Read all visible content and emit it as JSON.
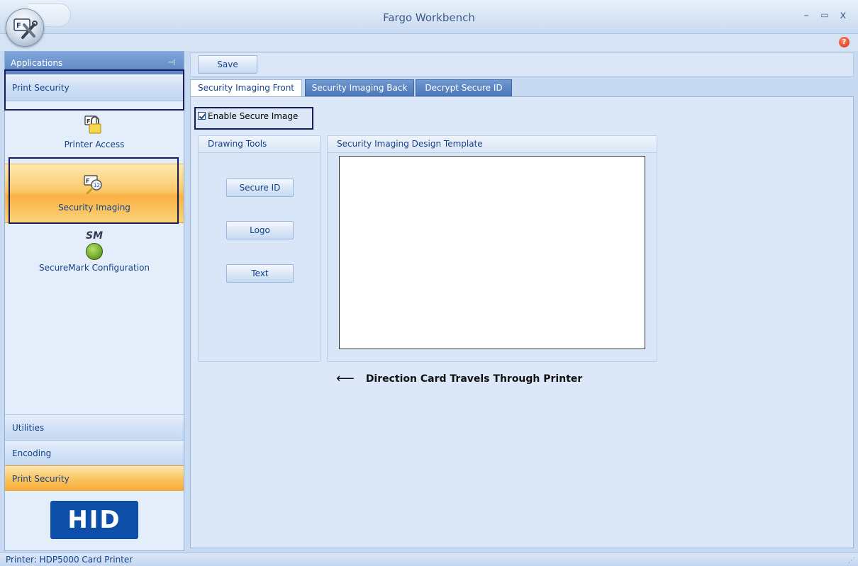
{
  "window": {
    "title": "Fargo Workbench",
    "minimize": "–",
    "maximize": "▭",
    "close": "x",
    "help": "?"
  },
  "sidebar": {
    "header": "Applications",
    "pin": "ᵮ",
    "group_title": "Print Security",
    "items": [
      {
        "label": "Printer Access",
        "icon": "lock-card-icon"
      },
      {
        "label": "Security Imaging",
        "icon": "magnifier-card-icon"
      },
      {
        "label": "SecureMark Configuration",
        "icon": "securemark-icon",
        "badge": "SM"
      }
    ],
    "bottom": [
      {
        "label": "Utilities"
      },
      {
        "label": "Encoding"
      },
      {
        "label": "Print Security"
      }
    ],
    "logo": "HID"
  },
  "toolbar": {
    "save_label": "Save"
  },
  "tabs": [
    {
      "label": "Security Imaging Front",
      "selected": true
    },
    {
      "label": "Security Imaging Back",
      "selected": false
    },
    {
      "label": "Decrypt Secure ID",
      "selected": false
    }
  ],
  "panel": {
    "enable_label": "Enable Secure Image",
    "enable_checked": true,
    "drawing_tools": {
      "title": "Drawing Tools",
      "buttons": [
        "Secure ID",
        "Logo",
        "Text"
      ]
    },
    "design_template": {
      "title": "Security Imaging Design Template"
    },
    "direction_arrow": "⟵",
    "direction_text": "Direction Card Travels Through Printer"
  },
  "status": {
    "text": "Printer:  HDP5000 Card Printer"
  },
  "colors": {
    "accent_orange": "#f9b142",
    "frame_blue": "#c8daf2",
    "highlight_border": "#1a1c5a"
  }
}
